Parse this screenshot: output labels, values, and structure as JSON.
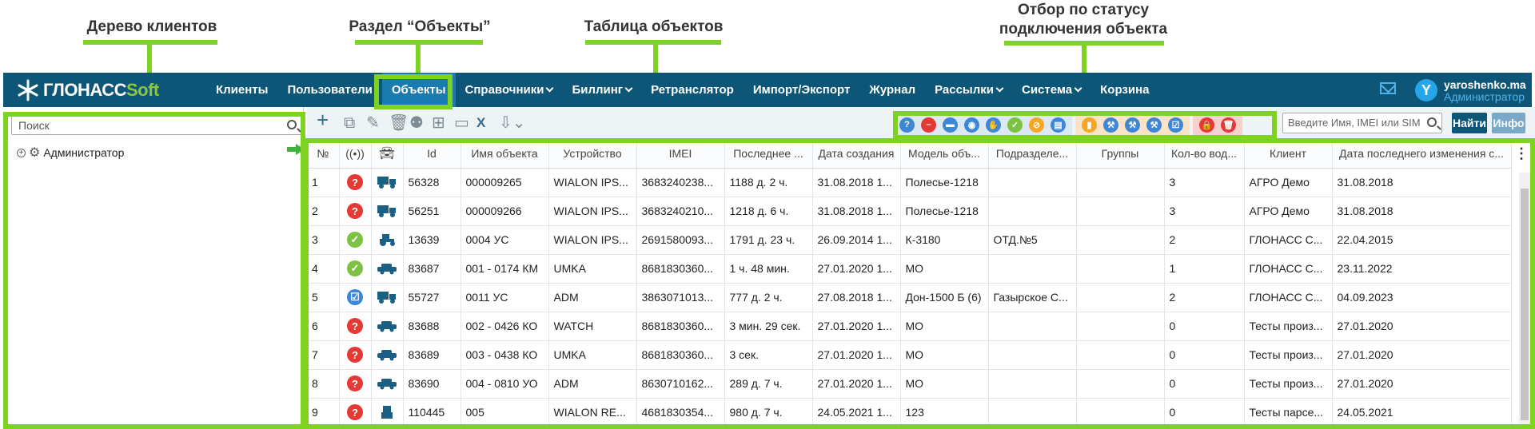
{
  "annotations": {
    "client_tree": "Дерево клиентов",
    "objects_section": "Раздел “Объекты”",
    "objects_table": "Таблица объектов",
    "status_filter_line1": "Отбор по статусу",
    "status_filter_line2": "подключения объекта"
  },
  "brand": {
    "part1": "ГЛОНАСС",
    "part2": "Soft",
    "accent": "#8dc63f",
    "header_bg": "#0e5677"
  },
  "nav": [
    {
      "label": "Клиенты",
      "dropdown": false,
      "active": false
    },
    {
      "label": "Пользователи",
      "dropdown": false,
      "active": false
    },
    {
      "label": "Объекты",
      "dropdown": false,
      "active": true
    },
    {
      "label": "Справочники",
      "dropdown": true,
      "active": false
    },
    {
      "label": "Биллинг",
      "dropdown": true,
      "active": false
    },
    {
      "label": "Ретранслятор",
      "dropdown": false,
      "active": false
    },
    {
      "label": "Импорт/Экспорт",
      "dropdown": false,
      "active": false
    },
    {
      "label": "Журнал",
      "dropdown": false,
      "active": false
    },
    {
      "label": "Рассылки",
      "dropdown": true,
      "active": false
    },
    {
      "label": "Система",
      "dropdown": true,
      "active": false
    },
    {
      "label": "Корзина",
      "dropdown": false,
      "active": false
    }
  ],
  "user": {
    "avatar_letter": "Y",
    "name": "yaroshenko.ma",
    "role": "Администратор"
  },
  "left": {
    "search_placeholder": "Поиск",
    "tree_root": "Администратор"
  },
  "toolbar": {
    "icons": [
      "add-icon",
      "copy-icon",
      "edit-icon",
      "delete-icon",
      "assign-user-icon",
      "hierarchy-icon",
      "terminal-icon",
      "excel-icon",
      "export-icon"
    ],
    "find_placeholder": "Введите Имя, IMEI или SIM",
    "find_label": "Найти",
    "info_label": "Инфо",
    "status_groups": [
      {
        "bg": "#dde9f2",
        "dots": [
          {
            "name": "unknown-status-icon",
            "color": "#3d87d4",
            "glyph": "?"
          },
          {
            "name": "blocked-status-icon",
            "color": "#e53935",
            "glyph": "–"
          },
          {
            "name": "disk-status-icon",
            "color": "#3d87d4",
            "glyph": "▬"
          },
          {
            "name": "visible-status-icon",
            "color": "#3d87d4",
            "glyph": "◉"
          },
          {
            "name": "hand-status-icon",
            "color": "#3d87d4",
            "glyph": "✋"
          },
          {
            "name": "online-status-icon",
            "color": "#7cc142",
            "glyph": "✓"
          },
          {
            "name": "no-connection-status-icon",
            "color": "#f5a623",
            "glyph": "⊘"
          },
          {
            "name": "cart-status-icon",
            "color": "#3d87d4",
            "glyph": "▤"
          }
        ]
      },
      {
        "bg": "#fbe3c8",
        "dots": [
          {
            "name": "chart-status-icon",
            "color": "#f5a623",
            "glyph": "▮"
          },
          {
            "name": "wrench-status-icon",
            "color": "#3d87d4",
            "glyph": "⚒"
          },
          {
            "name": "wrench2-status-icon",
            "color": "#3d87d4",
            "glyph": "⚒"
          },
          {
            "name": "wrench3-status-icon",
            "color": "#3d87d4",
            "glyph": "⚒"
          },
          {
            "name": "checked-status-icon",
            "color": "#3d87d4",
            "glyph": "☑"
          }
        ]
      },
      {
        "bg": "#f8d0d0",
        "dots": [
          {
            "name": "lock-status-icon",
            "color": "#e53935",
            "glyph": "🔒"
          },
          {
            "name": "trash-status-icon",
            "color": "#e53935",
            "glyph": "🗑"
          }
        ]
      }
    ]
  },
  "table": {
    "columns": [
      "№",
      "",
      "",
      "Id",
      "Имя объекта",
      "Устройство",
      "IMEI",
      "Последнее ...",
      "Дата создания",
      "Модель объ...",
      "Подразделе...",
      "Группы",
      "Кол-во вод...",
      "Клиент",
      "Дата последнего изменения с..."
    ],
    "rows": [
      {
        "n": "1",
        "status": "unknown",
        "vehicle": "truck",
        "id": "56328",
        "name": "000009265",
        "device": "WIALON IPS...",
        "imei": "3683240238...",
        "last": "1188 д. 2 ч.",
        "created": "31.08.2018 1...",
        "model": "Полесье-1218",
        "division": "",
        "groups": "",
        "drivers": "3",
        "client": "АГРО Демо",
        "changed": "31.08.2018"
      },
      {
        "n": "2",
        "status": "unknown",
        "vehicle": "truck",
        "id": "56251",
        "name": "000009266",
        "device": "WIALON IPS...",
        "imei": "3683240210...",
        "last": "1218 д. 6 ч.",
        "created": "31.08.2018 1...",
        "model": "Полесье-1218",
        "division": "",
        "groups": "",
        "drivers": "3",
        "client": "АГРО Демо",
        "changed": "31.08.2018"
      },
      {
        "n": "3",
        "status": "online",
        "vehicle": "tractor",
        "id": "13639",
        "name": "0004 УС",
        "device": "WIALON IPS...",
        "imei": "2691580093...",
        "last": "1791 д. 23 ч.",
        "created": "26.09.2014 1...",
        "model": "К-3180",
        "division": "ОТД.№5",
        "groups": "",
        "drivers": "2",
        "client": "ГЛОНАСС С...",
        "changed": "22.04.2015"
      },
      {
        "n": "4",
        "status": "online",
        "vehicle": "car",
        "id": "83687",
        "name": "001 - 0174 КМ",
        "device": "UMKA",
        "imei": "8681830360...",
        "last": "1 ч. 48 мин.",
        "created": "27.01.2020 1...",
        "model": "МО",
        "division": "",
        "groups": "",
        "drivers": "1",
        "client": "ГЛОНАСС С...",
        "changed": "23.11.2022"
      },
      {
        "n": "5",
        "status": "checked",
        "vehicle": "truck",
        "id": "55727",
        "name": "0011 УС",
        "device": "ADM",
        "imei": "3863071013...",
        "last": "777 д. 2 ч.",
        "created": "27.08.2018 1...",
        "model": "Дон-1500 Б (6)",
        "division": "Газырское С...",
        "groups": "",
        "drivers": "2",
        "client": "ГЛОНАСС С...",
        "changed": "04.09.2023"
      },
      {
        "n": "6",
        "status": "unknown",
        "vehicle": "car",
        "id": "83688",
        "name": "002 - 0426 КО",
        "device": "WATCH",
        "imei": "8681830360...",
        "last": "3 мин. 29 сек.",
        "created": "27.01.2020 1...",
        "model": "МО",
        "division": "",
        "groups": "",
        "drivers": "0",
        "client": "Тесты произ...",
        "changed": "27.01.2020"
      },
      {
        "n": "7",
        "status": "unknown",
        "vehicle": "car",
        "id": "83689",
        "name": "003 - 0438 КО",
        "device": "UMKA",
        "imei": "8681830360...",
        "last": "3 сек.",
        "created": "27.01.2020 1...",
        "model": "МО",
        "division": "",
        "groups": "",
        "drivers": "0",
        "client": "Тесты произ...",
        "changed": "27.01.2020"
      },
      {
        "n": "8",
        "status": "unknown",
        "vehicle": "car",
        "id": "83690",
        "name": "004 - 0810 УО",
        "device": "ADM",
        "imei": "8630710162...",
        "last": "289 д. 7 ч.",
        "created": "27.01.2020 1...",
        "model": "МО",
        "division": "",
        "groups": "",
        "drivers": "0",
        "client": "Тесты произ...",
        "changed": "27.01.2020"
      },
      {
        "n": "9",
        "status": "unknown",
        "vehicle": "robot",
        "id": "110445",
        "name": "005",
        "device": "WIALON RE...",
        "imei": "4681830354...",
        "last": "980 д. 7 ч.",
        "created": "24.05.2021 1...",
        "model": "123",
        "division": "",
        "groups": "",
        "drivers": "0",
        "client": "Тесты парсе...",
        "changed": "24.05.2021"
      }
    ]
  }
}
